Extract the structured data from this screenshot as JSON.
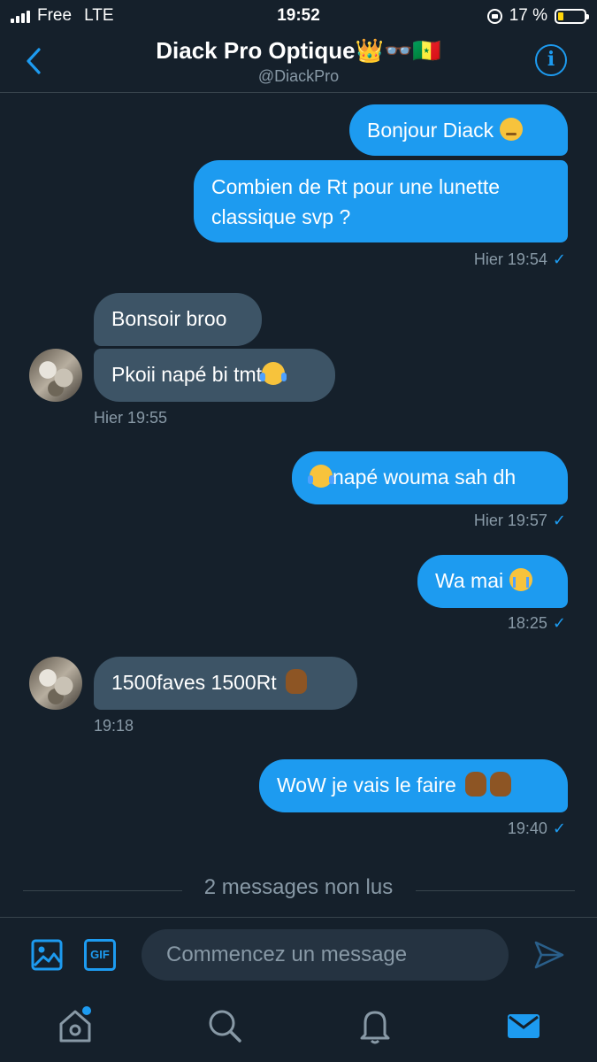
{
  "status_bar": {
    "carrier": "Free",
    "network": "LTE",
    "time": "19:52",
    "battery_percent": "17 %"
  },
  "header": {
    "title": "Diack Pro Optique👑👓🇸🇳",
    "handle": "@DiackPro"
  },
  "messages": [
    {
      "dir": "out",
      "text": "Bonjour Diack"
    },
    {
      "dir": "out",
      "line1": "Combien de Rt pour une lunette",
      "line2": "classique svp ?",
      "meta": "Hier 19:54"
    },
    {
      "dir": "in",
      "text": "Bonsoir broo"
    },
    {
      "dir": "in",
      "text": "Pkoii napé bi tmt",
      "meta": "Hier 19:55"
    },
    {
      "dir": "out",
      "text": "napé wouma sah dh",
      "meta": "Hier 19:57"
    },
    {
      "dir": "out",
      "text": "Wa mai",
      "meta": "18:25"
    },
    {
      "dir": "in",
      "text": "1500faves 1500Rt",
      "meta": "19:18"
    },
    {
      "dir": "out",
      "text": "WoW je vais le faire",
      "meta": "19:40"
    }
  ],
  "unread_label": "2 messages non lus",
  "composer": {
    "placeholder": "Commencez un message",
    "gif_label": "GIF"
  },
  "colors": {
    "background": "#15202b",
    "accent": "#1d9bf0",
    "incoming": "#3d5466",
    "muted": "#8899a6"
  },
  "icons": [
    "back-arrow-icon",
    "info-icon",
    "image-icon",
    "gif-icon",
    "send-icon",
    "home-icon",
    "search-icon",
    "bell-icon",
    "mail-icon"
  ]
}
